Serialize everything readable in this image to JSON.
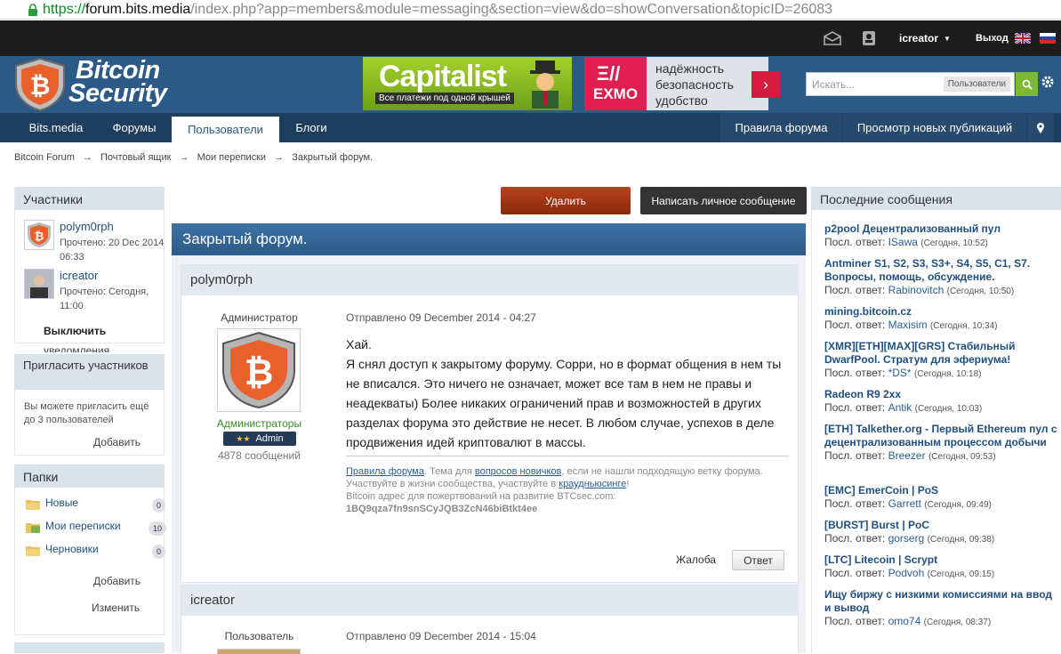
{
  "browser": {
    "url_proto": "https://",
    "url_host": "forum.bits.media",
    "url_path": "/index.php?app=members&module=messaging&section=view&do=showConversation&topicID=26083"
  },
  "topbar": {
    "username": "icreator",
    "logout": "Выход"
  },
  "logo": {
    "line1": "Bitcoin",
    "line2": "Security"
  },
  "ads": {
    "capitalist_word": "Capitalist",
    "capitalist_sub": "Все платежи под одной крышей",
    "exmo_word": "EXMO",
    "exmo_lines": [
      "надёжность",
      "безопасность",
      "удобство"
    ]
  },
  "search": {
    "placeholder": "Искать...",
    "scope": "Пользователи"
  },
  "nav": {
    "tabs": [
      "Bits.media",
      "Форумы",
      "Пользователи",
      "Блоги"
    ],
    "right": [
      "Правила форума",
      "Просмотр новых публикаций"
    ]
  },
  "breadcrumb": [
    "Bitcoin Forum",
    "→",
    "Почтовый ящик",
    "→",
    "Мои переписки",
    "→",
    "Закрытый форум."
  ],
  "participants": {
    "title": "Участники",
    "people": [
      {
        "name": "polym0rph",
        "status": "Прочтено: 20 Dec 2014 06:33"
      },
      {
        "name": "icreator",
        "status": "Прочтено: Сегодня, 11:00"
      }
    ],
    "disable": "Выключить",
    "disable2": "уведомления"
  },
  "invite": {
    "title": "Пригласить участников",
    "text": "Вы можете пригласить ещё до 3 пользователей",
    "add": "Добавить"
  },
  "folders": {
    "title": "Папки",
    "items": [
      {
        "label": "Новые",
        "count": "0"
      },
      {
        "label": "Мои переписки",
        "count": "10"
      },
      {
        "label": "Черновики",
        "count": "0"
      }
    ],
    "add": "Добавить",
    "edit": "Изменить"
  },
  "actions": {
    "delete": "Удалить",
    "write": "Написать личное сообщение"
  },
  "conversation": {
    "title": "Закрытый форум.",
    "posts": [
      {
        "author": "polym0rph",
        "role": "Администратор",
        "group": "Администраторы",
        "badge": "Admin",
        "count": "4878 сообщений",
        "date": "Отправлено 09 December 2014 - 04:27",
        "body": [
          "Хай.",
          "Я снял доступ к закрытому форуму. Сорри, но в формат общения в нем ты не вписался. Это ничего не означает, может все там в нем не правы и неадекваты) Более никаких ограничений прав и возможностей в других разделах форума это действие не несет. В любом случае, успехов в деле продвижения идей криптовалют в массы."
        ],
        "sig": {
          "rules": "Правила форума",
          "t1": ". Тема для ",
          "newbies": "вопросов новичков",
          "t2": ", если не нашли подходящую ветку форума.",
          "t3": "Участвуйте в жизни сообщества, участвуйте в ",
          "crowd": "краудньюсинге",
          "t4": "!",
          "t5": "Bitcoin адрес для пожертвований на развитие BTCsec.com:",
          "addr": "1BQ9qza7fn9snSCyJQB3ZcN46biBtkt4ee"
        },
        "report": "Жалоба",
        "reply": "Ответ"
      },
      {
        "author": "icreator",
        "role": "Пользователь",
        "date": "Отправлено 09 December 2014 - 15:04"
      }
    ]
  },
  "recent": {
    "title": "Последние сообщения",
    "prefix": "Посл. ответ:",
    "topics": [
      {
        "title": "p2pool Децентрализованный пул",
        "user": "ISawa",
        "time": "(Сегодня, 10:52)"
      },
      {
        "title": "Antminer S1, S2, S3, S3+, S4, S5, C1, S7. Вопросы, помощь, обсуждение.",
        "user": "Rabinovitch",
        "time": "(Сегодня, 10:50)"
      },
      {
        "title": "mining.bitcoin.cz",
        "user": "Maxisim",
        "time": "(Сегодня, 10:34)"
      },
      {
        "title": "[XMR][ETH][MAX][GRS] Стабильный DwarfPool. Стратум для эфериума!",
        "user": "*DS*",
        "time": "(Сегодня, 10:18)"
      },
      {
        "title": "Radeon R9 2xx",
        "user": "Antik",
        "time": "(Сегодня, 10:03)"
      },
      {
        "title": "[ETH] Talkether.org - Первый Ethereum пул с децентрализованным процессом добычи",
        "user": "Breezer",
        "time": "(Сегодня, 09:53)"
      },
      {
        "title": "[EMC] EmerCoin | PoS",
        "user": "Garrett",
        "time": "(Сегодня, 09:49)"
      },
      {
        "title": "[BURST] Burst | PoC",
        "user": "gorserg",
        "time": "(Сегодня, 09:38)"
      },
      {
        "title": "[LTC] Litecoin | Scrypt",
        "user": "Podvoh",
        "time": "(Сегодня, 09:15)"
      },
      {
        "title": "Ищу биржу с низкими комиссиями на ввод и вывод",
        "user": "omo74",
        "time": "(Сегодня, 08:37)"
      }
    ]
  }
}
